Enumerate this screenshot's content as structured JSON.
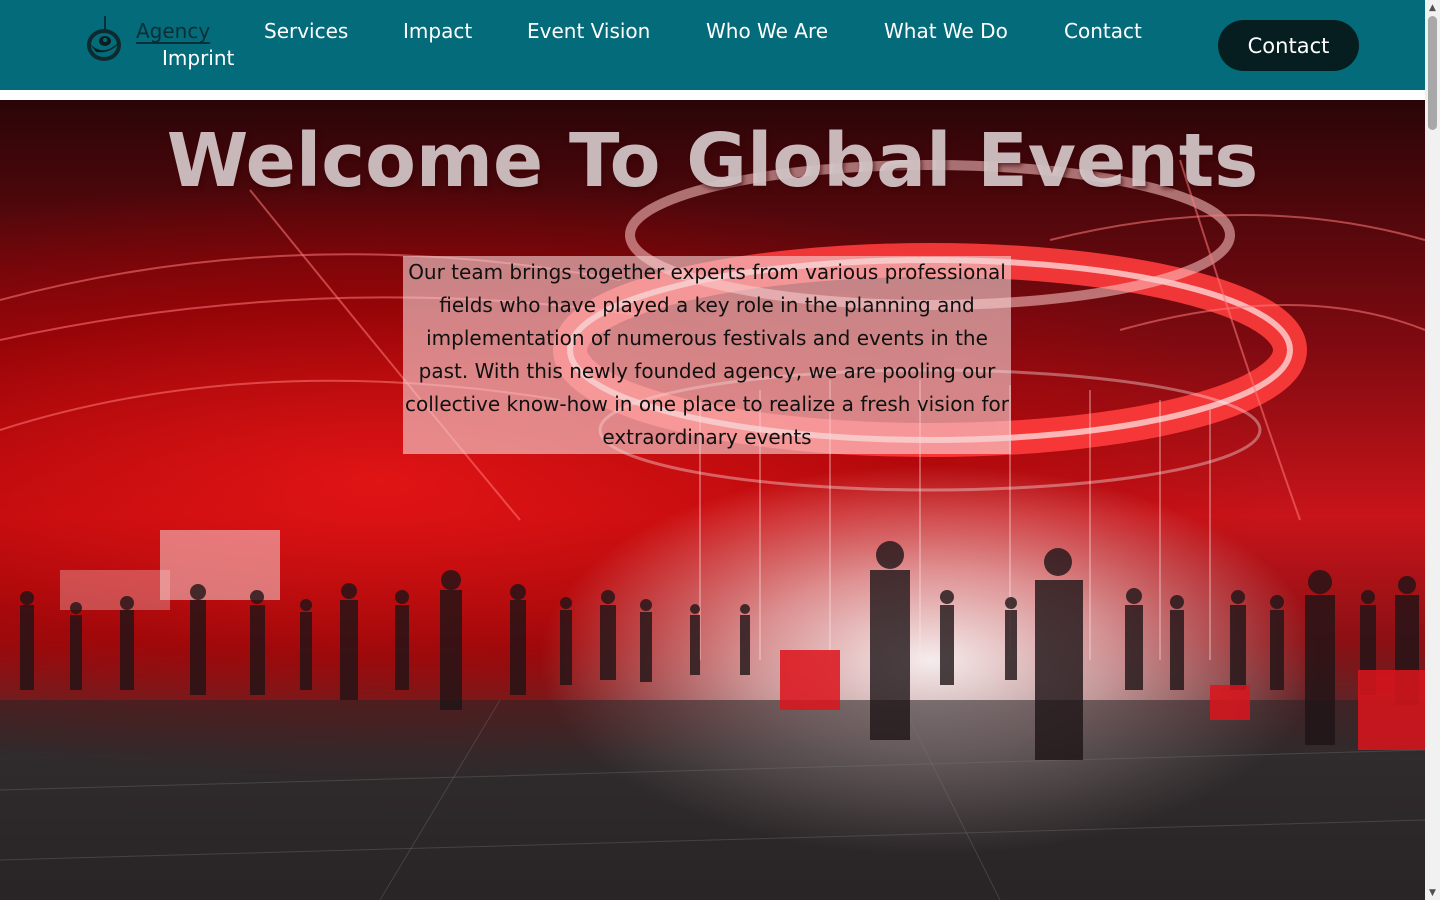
{
  "nav": {
    "agency": "Agency",
    "imprint": "Imprint",
    "services": "Services",
    "impact": "Impact",
    "event_vision": "Event Vision",
    "who_we_are": "Who We Are",
    "what_we_do": "What We Do",
    "contact": "Contact"
  },
  "header": {
    "cta_label": "Contact",
    "logo_icon": "globe-logo-icon",
    "background_color": "#046b7b",
    "cta_color": "#071e20"
  },
  "hero": {
    "title": "Welcome To Global Events",
    "description": "Our team brings together experts from various professional fields who have played a key role in the planning and implementation of numerous festivals and events in the past. With this newly founded agency, we are pooling our collective know-how in one place to realize a fresh vision for extraordinary events",
    "accent_color": "#e0141c"
  },
  "scrollbar": {
    "up_icon": "scroll-up-arrow-icon",
    "down_icon": "scroll-down-arrow-icon"
  }
}
